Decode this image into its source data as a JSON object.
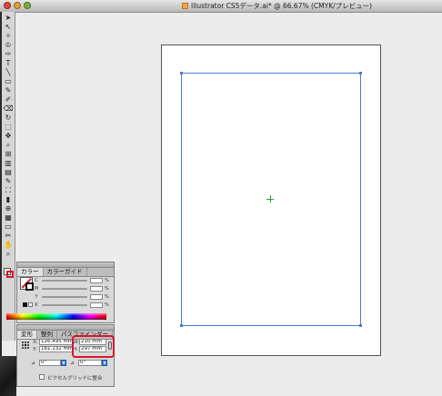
{
  "window": {
    "title": "Illustrator CS5データ.ai* @ 66.67% (CMYK/プレビュー)"
  },
  "toolbox": {
    "tools": [
      "➤",
      "↖",
      "✧",
      "♔",
      "✑",
      "T",
      "╲",
      "▭",
      "✎",
      "✐",
      "⌫",
      "↻",
      "⬚",
      "✥",
      "⌕",
      "⊞",
      "▥",
      "▤",
      "✎",
      "⛶",
      "▮",
      "⊕",
      "▦",
      "▭",
      "✂",
      "✋",
      "⌕"
    ]
  },
  "color_panel": {
    "tabs": [
      "カラー",
      "カラーガイド"
    ],
    "channels": [
      {
        "label": "C",
        "unit": "%"
      },
      {
        "label": "M",
        "unit": "%"
      },
      {
        "label": "Y",
        "unit": "%"
      },
      {
        "label": "K",
        "unit": "%"
      }
    ]
  },
  "transform_panel": {
    "tabs": [
      "変形",
      "整列",
      "パスファインダー"
    ],
    "x_label": "X:",
    "x_value": "126.495 mm",
    "y_label": "Y:",
    "y_value": "181.132 mm",
    "w_label": "W:",
    "w_value": "210 mm",
    "h_label": "H:",
    "h_value": "297 mm",
    "rotate_value": "0°",
    "shear_value": "0°",
    "pixel_grid_label": "ピクセルグリッドに整合"
  },
  "colors": {
    "highlight": "#d9152b",
    "selection": "#4d79d9",
    "center_mark": "#2fa52f"
  }
}
